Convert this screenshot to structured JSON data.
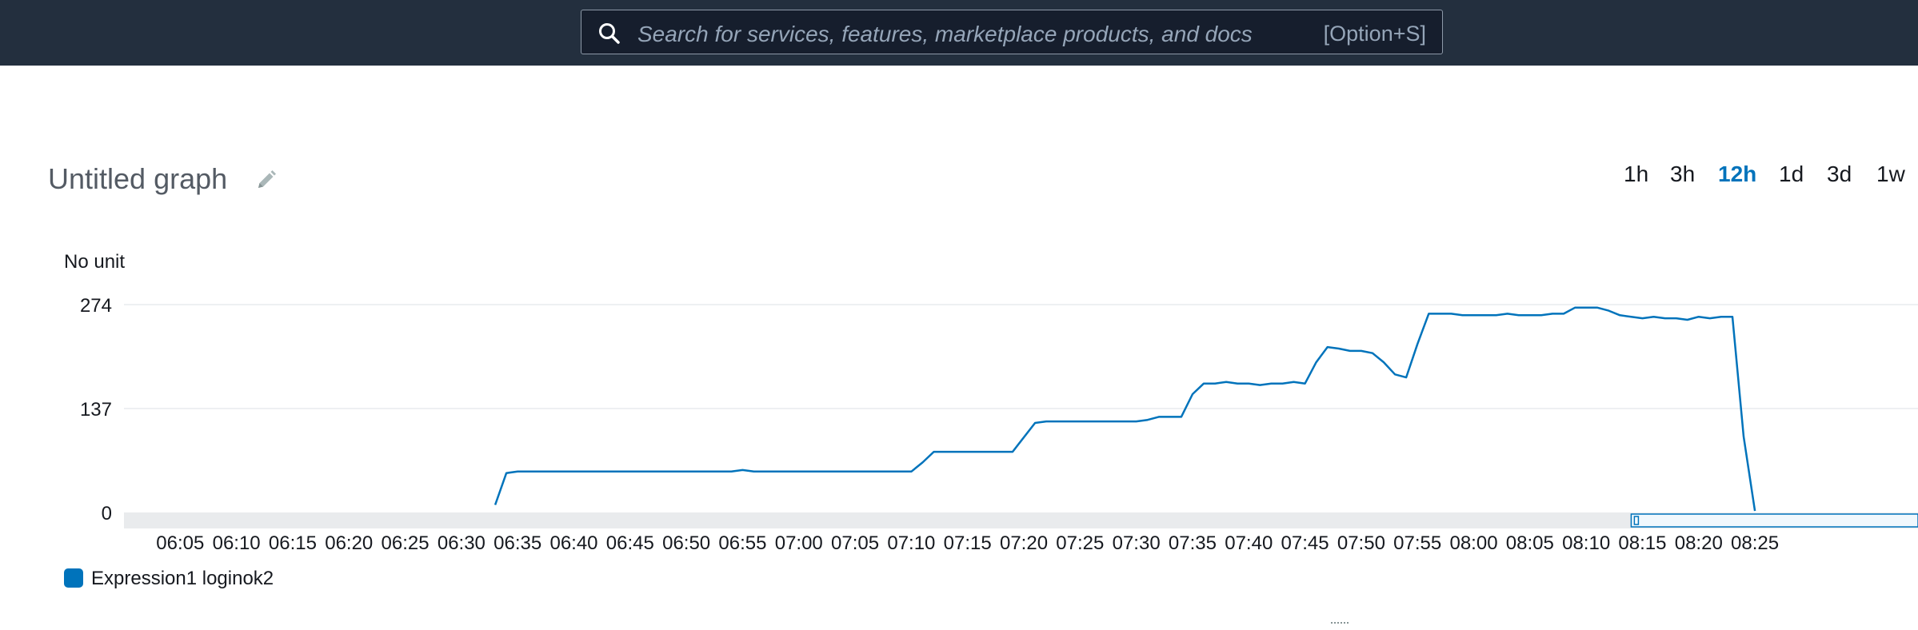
{
  "search": {
    "placeholder": "Search for services, features, marketplace products, and docs",
    "shortcut": "[Option+S]",
    "icon": "search-icon"
  },
  "graph": {
    "title": "Untitled graph",
    "edit_icon": "pencil-icon",
    "time_ranges": [
      {
        "label": "1h",
        "active": false
      },
      {
        "label": "3h",
        "active": false
      },
      {
        "label": "12h",
        "active": true
      },
      {
        "label": "1d",
        "active": false
      },
      {
        "label": "3d",
        "active": false
      },
      {
        "label": "1w",
        "active": false
      }
    ],
    "active_color": "#0073bb"
  },
  "chart_data": {
    "type": "line",
    "title": "Untitled graph",
    "ylabel": "No unit",
    "xlabel": "",
    "ylim": [
      0,
      274
    ],
    "yticks": [
      "0",
      "137",
      "274"
    ],
    "xticks": [
      "06:05",
      "06:10",
      "06:15",
      "06:20",
      "06:25",
      "06:30",
      "06:35",
      "06:40",
      "06:45",
      "06:50",
      "06:55",
      "07:00",
      "07:05",
      "07:10",
      "07:15",
      "07:20",
      "07:25",
      "07:30",
      "07:35",
      "07:40",
      "07:45",
      "07:50",
      "07:55",
      "08:00",
      "08:05",
      "08:10",
      "08:15",
      "08:20",
      "08:25"
    ],
    "grid": true,
    "legend": "bottom-left",
    "series": [
      {
        "name": "Expression1 loginok2",
        "color": "#0073bb",
        "points": [
          [
            "06:33",
            10
          ],
          [
            "06:34",
            52
          ],
          [
            "06:35",
            54
          ],
          [
            "06:40",
            54
          ],
          [
            "06:45",
            54
          ],
          [
            "06:50",
            54
          ],
          [
            "06:54",
            54
          ],
          [
            "06:55",
            56
          ],
          [
            "06:56",
            54
          ],
          [
            "07:00",
            54
          ],
          [
            "07:05",
            54
          ],
          [
            "07:10",
            54
          ],
          [
            "07:11",
            66
          ],
          [
            "07:12",
            80
          ],
          [
            "07:15",
            80
          ],
          [
            "07:19",
            80
          ],
          [
            "07:21",
            118
          ],
          [
            "07:22",
            120
          ],
          [
            "07:25",
            120
          ],
          [
            "07:30",
            120
          ],
          [
            "07:31",
            122
          ],
          [
            "07:32",
            126
          ],
          [
            "07:34",
            126
          ],
          [
            "07:35",
            156
          ],
          [
            "07:36",
            170
          ],
          [
            "07:37",
            170
          ],
          [
            "07:38",
            172
          ],
          [
            "07:39",
            170
          ],
          [
            "07:40",
            170
          ],
          [
            "07:41",
            168
          ],
          [
            "07:42",
            170
          ],
          [
            "07:43",
            170
          ],
          [
            "07:44",
            172
          ],
          [
            "07:45",
            170
          ],
          [
            "07:46",
            198
          ],
          [
            "07:47",
            218
          ],
          [
            "07:48",
            216
          ],
          [
            "07:49",
            213
          ],
          [
            "07:50",
            213
          ],
          [
            "07:51",
            210
          ],
          [
            "07:52",
            198
          ],
          [
            "07:53",
            182
          ],
          [
            "07:54",
            178
          ],
          [
            "07:55",
            222
          ],
          [
            "07:56",
            262
          ],
          [
            "07:57",
            262
          ],
          [
            "07:58",
            262
          ],
          [
            "07:59",
            260
          ],
          [
            "08:00",
            260
          ],
          [
            "08:02",
            260
          ],
          [
            "08:03",
            262
          ],
          [
            "08:04",
            260
          ],
          [
            "08:06",
            260
          ],
          [
            "08:07",
            262
          ],
          [
            "08:08",
            262
          ],
          [
            "08:09",
            270
          ],
          [
            "08:10",
            270
          ],
          [
            "08:11",
            270
          ],
          [
            "08:12",
            266
          ],
          [
            "08:13",
            260
          ],
          [
            "08:14",
            258
          ],
          [
            "08:15",
            256
          ],
          [
            "08:16",
            258
          ],
          [
            "08:17",
            256
          ],
          [
            "08:18",
            256
          ],
          [
            "08:19",
            254
          ],
          [
            "08:20",
            258
          ],
          [
            "08:21",
            256
          ],
          [
            "08:22",
            258
          ],
          [
            "08:23",
            258
          ],
          [
            "08:24",
            100
          ],
          [
            "08:25",
            2
          ]
        ]
      }
    ]
  }
}
